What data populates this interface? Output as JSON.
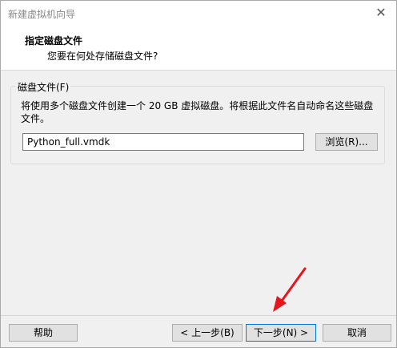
{
  "window": {
    "title": "新建虚拟机向导",
    "close_glyph": "✕"
  },
  "header": {
    "title": "指定磁盘文件",
    "subtitle": "您要在何处存储磁盘文件?"
  },
  "disk_file_group": {
    "legend": "磁盘文件(F)",
    "description": "将使用多个磁盘文件创建一个 20 GB 虚拟磁盘。将根据此文件名自动命名这些磁盘文件。",
    "filename_value": "Python_full.vmdk",
    "browse_label": "浏览(R)..."
  },
  "footer": {
    "help_label": "帮助",
    "back_label": "< 上一步(B)",
    "next_label": "下一步(N) >",
    "cancel_label": "取消"
  },
  "colors": {
    "annotation_arrow": "#e8141c"
  }
}
